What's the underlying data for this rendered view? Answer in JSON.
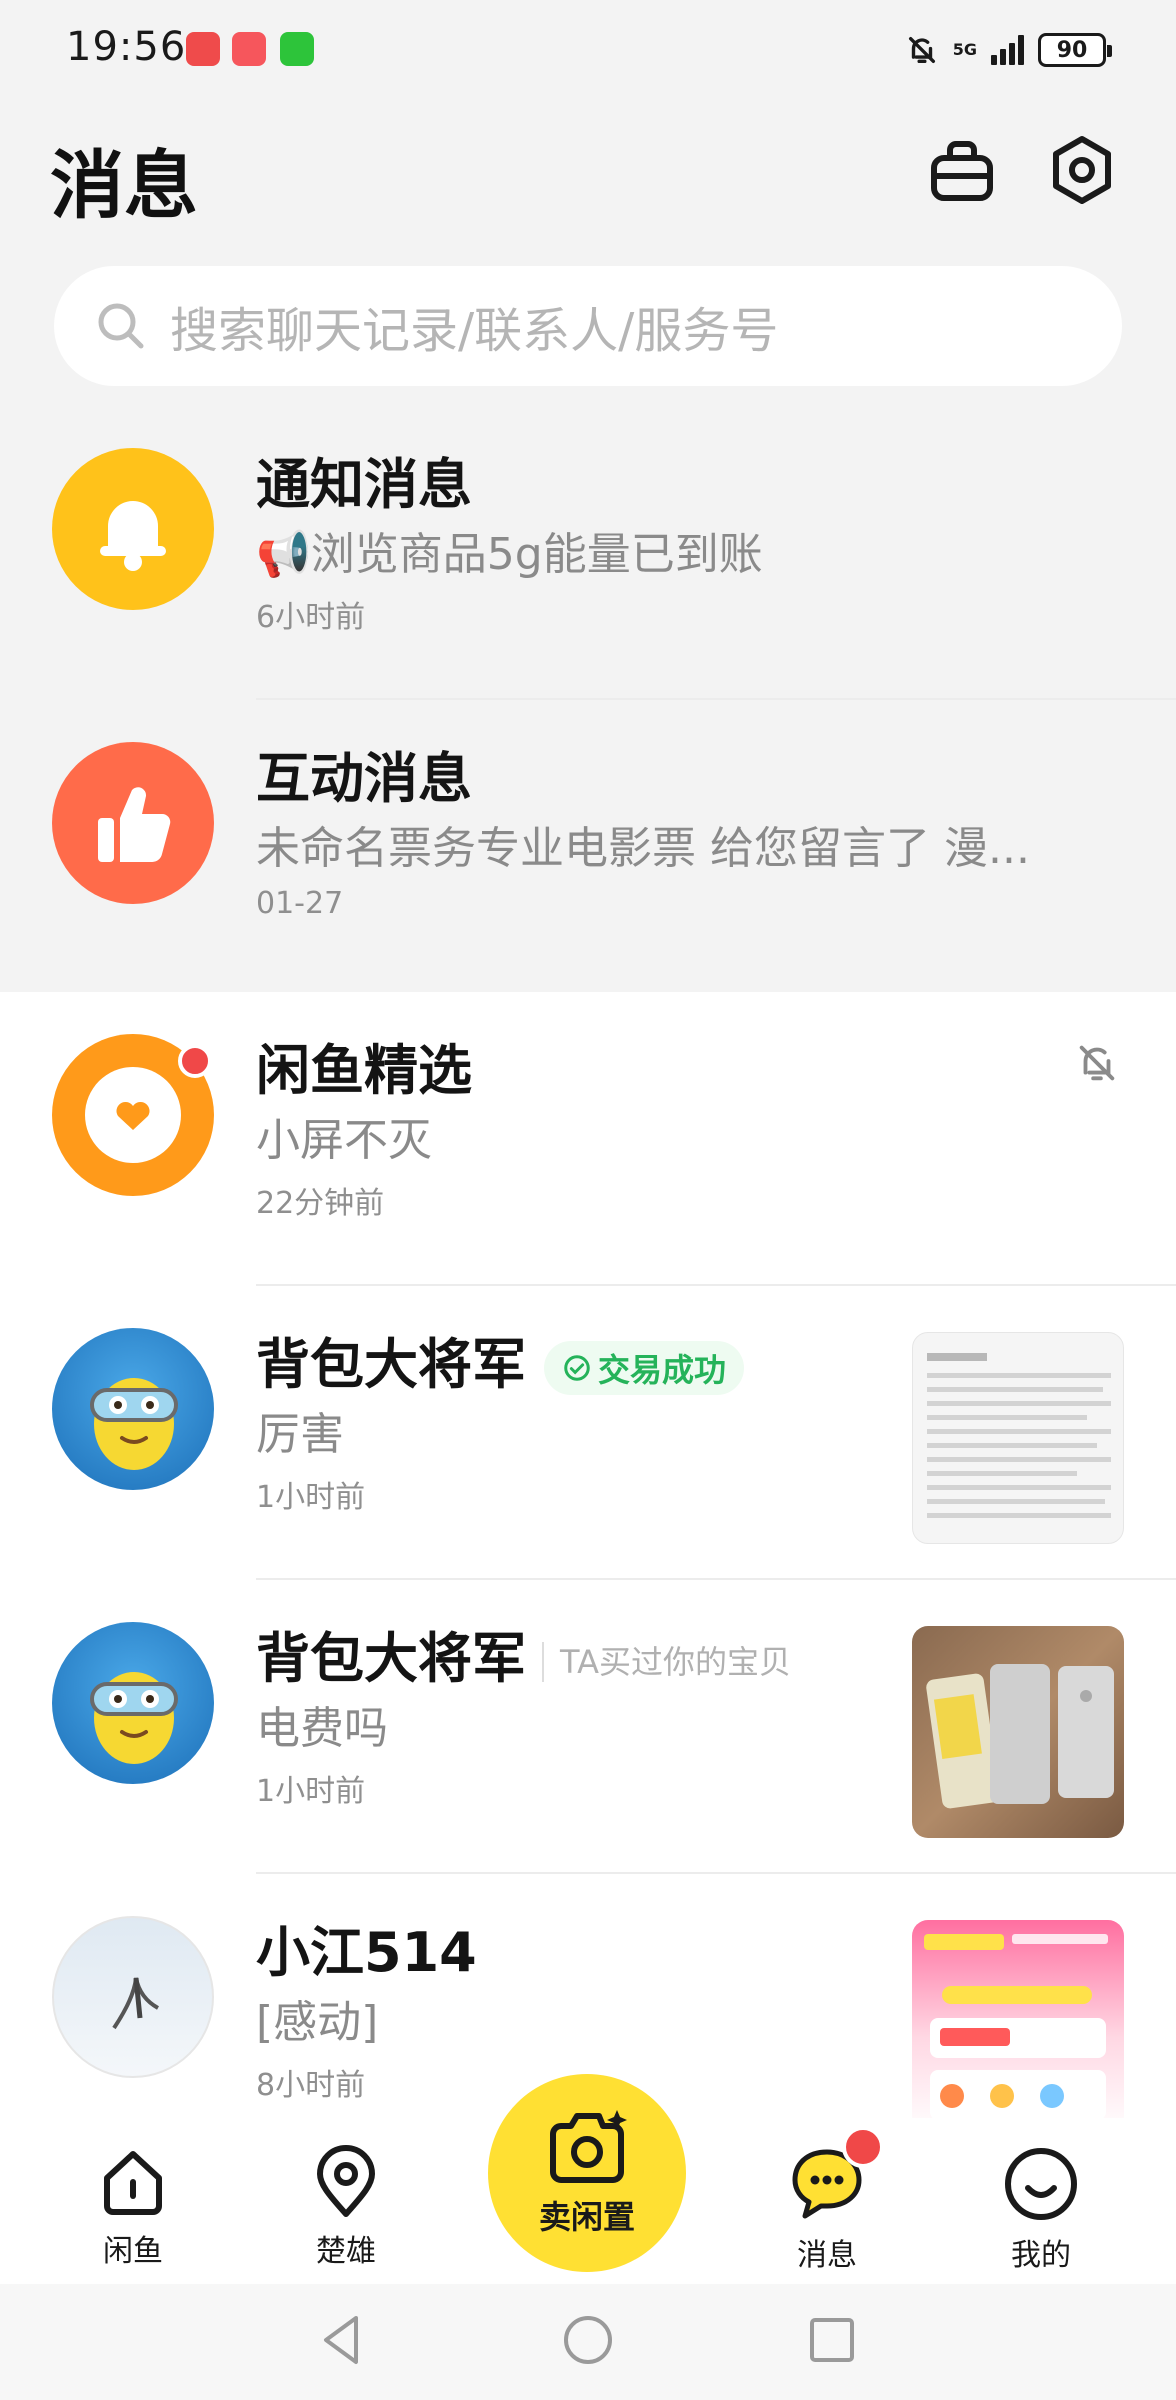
{
  "status_bar": {
    "time": "19:56",
    "network": "5G",
    "battery": "90"
  },
  "header": {
    "title": "消息",
    "icons": [
      "bag-icon",
      "settings-icon"
    ]
  },
  "search": {
    "placeholder": "搜索聊天记录/联系人/服务号"
  },
  "conversations": [
    {
      "title": "通知消息",
      "message": "📢浏览商品5g能量已到账",
      "time": "6小时前",
      "avatar_icon": "bell-icon",
      "avatar_color": "#ffc21a"
    },
    {
      "title": "互动消息",
      "message": "未命名票务专业电影票 给您留言了 漫...",
      "time": "01-27",
      "avatar_icon": "thumbs-up-icon",
      "avatar_color": "#ff6b4a"
    },
    {
      "title": "闲鱼精选",
      "message": "小屏不灭",
      "time": "22分钟前",
      "avatar_icon": "heart-icon",
      "avatar_color": "#ff9a1a",
      "muted": true,
      "unread_dot": true
    },
    {
      "title": "背包大将军",
      "badge": "交易成功",
      "message": "厉害",
      "time": "1小时前",
      "avatar_icon": "minion-avatar-icon",
      "thumbnail": "document-thumbnail"
    },
    {
      "title": "背包大将军",
      "tag": "TA买过你的宝贝",
      "message": "电费吗",
      "time": "1小时前",
      "avatar_icon": "minion-avatar-icon",
      "thumbnail": "phones-thumbnail"
    },
    {
      "title": "小江514",
      "message": "[感动]",
      "time": "8小时前",
      "avatar_icon": "seagull-avatar-icon",
      "thumbnail": "promo-thumbnail"
    }
  ],
  "bottom_nav": {
    "items": [
      {
        "label": "闲鱼",
        "icon": "home-icon"
      },
      {
        "label": "楚雄",
        "icon": "location-icon"
      },
      {
        "label": "卖闲置",
        "icon": "camera-icon"
      },
      {
        "label": "消息",
        "icon": "chat-icon",
        "unread_dot": true
      },
      {
        "label": "我的",
        "icon": "smile-icon"
      }
    ],
    "accent": "#ffe033"
  },
  "colors": {
    "top_background": "#f3f3f3",
    "success_green": "#25b35a",
    "unread_red": "#f04848"
  }
}
